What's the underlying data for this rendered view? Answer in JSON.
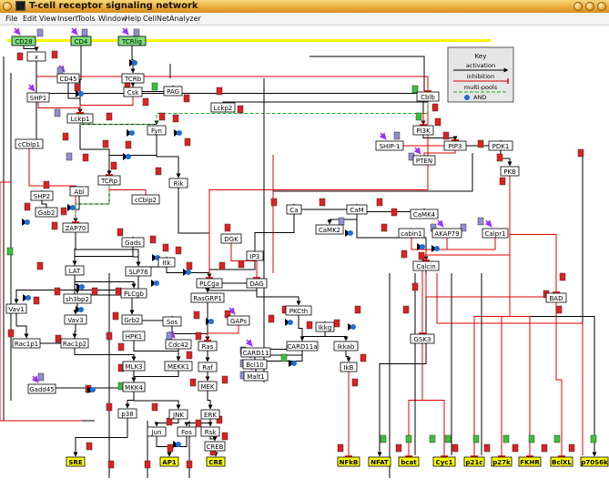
{
  "window": {
    "title": "T-cell receptor signaling network"
  },
  "menu": [
    "File",
    "Edit",
    "View",
    "Insert",
    "Tools",
    "Window",
    "Help",
    "CellNetAnalyzer"
  ],
  "legend": {
    "title": "Key",
    "items": [
      "activation",
      "inhibition",
      "multi-pools",
      "AND"
    ]
  },
  "nodes": {
    "CD28": "CD28",
    "CD4": "CD4",
    "TCRlig": "TCRlig",
    "x": "x",
    "CD45": "CD45",
    "TCRb": "TCRb",
    "Csk": "Csk",
    "PAG": "PAG",
    "SHP1": "SHP1",
    "Lckp1": "Lckp1",
    "Lckp2": "Lckp2",
    "Fyn": "Fyn",
    "cCblp1": "cCblp1",
    "Cblb": "Cblb",
    "PI3K": "PI3K",
    "SHIP1": "SHIP-1",
    "PIP3": "PIP3",
    "PDK1": "PDK1",
    "PTEN": "PTEN",
    "PKB": "PKB",
    "Abl": "Abl",
    "TCRp": "TCRp",
    "cCblp2": "cCblp2",
    "Rlk": "Rlk",
    "SHP2": "SHP2",
    "Gab2": "Gab2",
    "ZAP70": "ZAP70",
    "Gads": "Gads",
    "LAT": "LAT",
    "Itk": "Itk",
    "SLP76": "SLP76",
    "DGK": "DGK",
    "IP3": "IP3",
    "Ca": "Ca",
    "CaM": "CaM",
    "CaMK4": "CaMK4",
    "CaMK2": "CaMK2",
    "cabin1": "cabin1",
    "AKAP79": "AKAP79",
    "Calpr1": "Calpr1",
    "Calcin": "Calcin",
    "PLCga": "PLCga",
    "DAG": "DAG",
    "RasGRP1": "RasGRP1",
    "PLCgb": "PLCgb",
    "sh3bp2": "sh3bp2",
    "Vav1": "Vav1",
    "Vav3": "Vav3",
    "Grb2": "Grb2",
    "Sos": "Sos",
    "GAPs": "GAPs",
    "PKCth": "PKCth",
    "Ikkg": "Ikkg",
    "CARD11a": "CARD11a",
    "Ikkab": "Ikkab",
    "IkB": "IkB",
    "Rac1p1": "Rac1p1",
    "Rac1p2": "Rac1p2",
    "HPK1": "HPK1",
    "Cdc42": "Cdc42",
    "Ras": "Ras",
    "CARD11": "CARD11",
    "Bcl10": "Bcl10",
    "Malt1": "Malt1",
    "MLK3": "MLK3",
    "MEKK1": "MEKK1",
    "Raf": "Raf",
    "MKK4": "MKK4",
    "MEK": "MEK",
    "Gadd45": "Gadd45",
    "p38": "p38",
    "JNK": "JNK",
    "ERK": "ERK",
    "Jun": "Jun",
    "Fos": "Fos",
    "Rsk": "Rsk",
    "CREB": "CREB",
    "GSK3": "GSK3",
    "BAD": "BAD"
  },
  "outputs": {
    "SRE": "SRE",
    "AP1": "AP1",
    "CRE": "CRE",
    "NFkB": "NFkB",
    "NFAT": "NFAT",
    "bcat": "bcat",
    "Cyc1": "Cyc1",
    "p21c": "p21c",
    "p27k": "p27k",
    "FKHR": "FKHR",
    "BclXL": "BclXL",
    "p70S6k": "p70S6k"
  },
  "colors": {
    "titlebar": "#e9a93a",
    "yellow_bar": "#f4f40a",
    "input_node": "#7ee07e",
    "output_node": "#ffff00",
    "activation_edge": "#000000",
    "inhibition_edge": "#e00000",
    "multipool_edge": "#22aa22",
    "and_node": "#1e6fd9",
    "red_marker": "#e02020",
    "green_marker": "#39c239",
    "blue_marker": "#8f8fd0",
    "input_arrow": "#9b30ff"
  }
}
